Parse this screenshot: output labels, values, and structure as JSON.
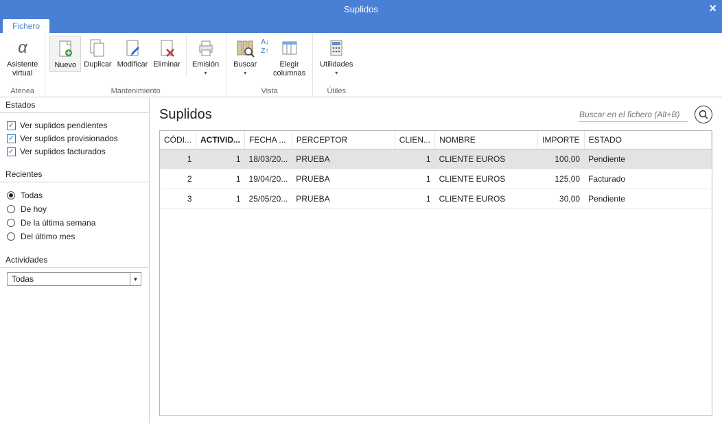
{
  "window": {
    "title": "Suplidos"
  },
  "tabs": {
    "active": "Fichero"
  },
  "ribbon": {
    "atenea": {
      "label": "Asistente\nvirtual",
      "group": "Atenea"
    },
    "mantenimiento": {
      "group": "Mantenimiento",
      "nuevo": "Nuevo",
      "duplicar": "Duplicar",
      "modificar": "Modificar",
      "eliminar": "Eliminar",
      "emision": "Emisión"
    },
    "vista": {
      "group": "Vista",
      "buscar": "Buscar",
      "elegir": "Elegir\ncolumnas"
    },
    "utiles": {
      "group": "Útiles",
      "utilidades": "Utilidades"
    }
  },
  "sidebar": {
    "estados": {
      "header": "Estados",
      "pendientes": "Ver suplidos pendientes",
      "provisionados": "Ver suplidos provisionados",
      "facturados": "Ver suplidos facturados"
    },
    "recientes": {
      "header": "Recientes",
      "todas": "Todas",
      "hoy": "De hoy",
      "semana": "De la última semana",
      "mes": "Del último mes"
    },
    "actividades": {
      "header": "Actividades",
      "selected": "Todas"
    }
  },
  "content": {
    "title": "Suplidos",
    "search_placeholder": "Buscar en el fichero (Alt+B)",
    "columns": {
      "codigo": "CÓDI...",
      "actividad": "ACTIVID...",
      "fecha": "FECHA ...",
      "perceptor": "PERCEPTOR",
      "cliente": "CLIEN...",
      "nombre": "NOMBRE",
      "importe": "IMPORTE",
      "estado": "ESTADO"
    },
    "rows": [
      {
        "codigo": "1",
        "actividad": "1",
        "fecha": "18/03/20...",
        "perceptor": "PRUEBA",
        "cliente": "1",
        "nombre": "CLIENTE EUROS",
        "importe": "100,00",
        "estado": "Pendiente"
      },
      {
        "codigo": "2",
        "actividad": "1",
        "fecha": "19/04/20...",
        "perceptor": "PRUEBA",
        "cliente": "1",
        "nombre": "CLIENTE EUROS",
        "importe": "125,00",
        "estado": "Facturado"
      },
      {
        "codigo": "3",
        "actividad": "1",
        "fecha": "25/05/20...",
        "perceptor": "PRUEBA",
        "cliente": "1",
        "nombre": "CLIENTE EUROS",
        "importe": "30,00",
        "estado": "Pendiente"
      }
    ]
  }
}
